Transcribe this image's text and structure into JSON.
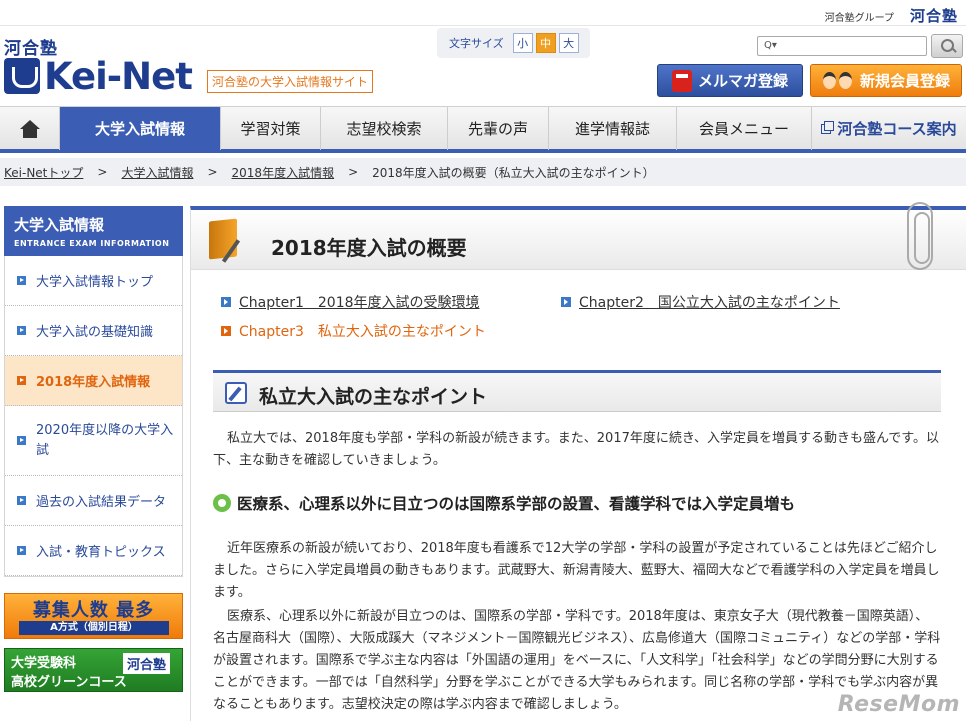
{
  "top": {
    "group": "河合塾グループ",
    "kawai_logo": "河合塾"
  },
  "logo": {
    "top": "河合塾",
    "main": "Kei-Net",
    "tagline": "河合塾の大学入試情報サイト"
  },
  "fontsize": {
    "label": "文字サイズ",
    "small": "小",
    "medium": "中",
    "large": "大"
  },
  "search": {
    "placeholder": "Q▾"
  },
  "buttons": {
    "mail": "メルマガ登録",
    "member": "新規会員登録"
  },
  "nav": {
    "items": [
      "大学入試情報",
      "学習対策",
      "志望校検索",
      "先輩の声",
      "進学情報誌",
      "会員メニュー"
    ],
    "course": "河合塾コース案内"
  },
  "breadcrumb": {
    "items": [
      "Kei-Netトップ",
      "大学入試情報",
      "2018年度入試情報"
    ],
    "current": "2018年度入試の概要（私立大入試の主なポイント）",
    "sep": ">"
  },
  "sidebar": {
    "title": "大学入試情報",
    "subtitle": "ENTRANCE EXAM INFORMATION",
    "items": [
      "大学入試情報トップ",
      "大学入試の基礎知識",
      "2018年度入試情報",
      "2020年度以降の大学入試",
      "過去の入試結果データ",
      "入試・教育トピックス"
    ]
  },
  "banners": {
    "recruit_title": "募集人数 最多",
    "recruit_sub": "A方式（個別日程）",
    "green_line1": "大学受験科",
    "green_line2": "高校グリーンコース",
    "green_kawai": "河合塾"
  },
  "main": {
    "title": "2018年度入試の概要",
    "chapters": [
      {
        "label": "Chapter1　2018年度入試の受験環境"
      },
      {
        "label": "Chapter2　国公立大入試の主なポイント"
      },
      {
        "label": "Chapter3　私立大入試の主なポイント"
      }
    ],
    "section_title": "私立大入試の主なポイント",
    "intro": "私立大では、2018年度も学部・学科の新設が続きます。また、2017年度に続き、入学定員を増員する動きも盛んです。以下、主な動きを確認していきましょう。",
    "sub_heading": "医療系、心理系以外に目立つのは国際系学部の設置、看護学科では入学定員増も",
    "para1": "近年医療系の新設が続いており、2018年度も看護系で12大学の学部・学科の設置が予定されていることは先ほどご紹介しました。さらに入学定員増員の動きもあります。武蔵野大、新潟青陵大、藍野大、福岡大などで看護学科の入学定員を増員します。",
    "para2": "医療系、心理系以外に新設が目立つのは、国際系の学部・学科です。2018年度は、東京女子大（現代教養－国際英語）、名古屋商科大（国際）、大阪成蹊大（マネジメント－国際観光ビジネス）、広島修道大（国際コミュニティ）などの学部・学科が設置されます。国際系で学ぶ主な内容は「外国語の運用」をベースに、「人文科学」「社会科学」などの学問分野に大別することができます。一部では「自然科学」分野を学ぶことができる大学もみられます。同じ名称の学部・学科でも学ぶ内容が異なることもあります。志望校決定の際は学ぶ内容まで確認しましょう。"
  },
  "watermark": "ReseMom"
}
